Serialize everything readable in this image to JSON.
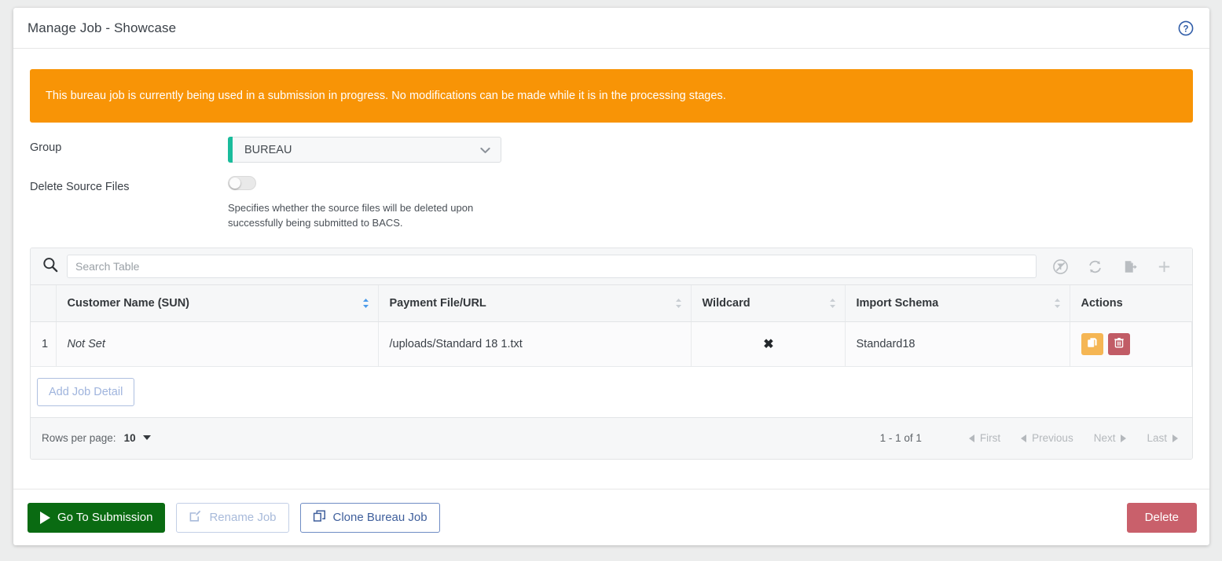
{
  "header": {
    "title": "Manage Job - Showcase",
    "help_icon": "help-circle-icon"
  },
  "banner": {
    "text": "This bureau job is currently being used in a submission in progress. No modifications can be made while it is in the processing stages.",
    "color": "#f89406"
  },
  "form": {
    "group": {
      "label": "Group",
      "value": "BUREAU",
      "accent_color": "#1abc9c"
    },
    "delete_source_files": {
      "label": "Delete Source Files",
      "state": "off",
      "help_text": "Specifies whether the source files will be deleted upon successfully being submitted to BACS."
    }
  },
  "table": {
    "search": {
      "placeholder": "Search Table",
      "value": ""
    },
    "toolbar": [
      {
        "name": "clear-filter-icon",
        "label": "Clear Filters"
      },
      {
        "name": "refresh-icon",
        "label": "Refresh"
      },
      {
        "name": "export-icon",
        "label": "Export"
      },
      {
        "name": "add-icon",
        "label": "Add"
      }
    ],
    "columns": [
      {
        "label": "Customer Name (SUN)",
        "sortable": true,
        "sort_active": true
      },
      {
        "label": "Payment File/URL",
        "sortable": true,
        "sort_active": false
      },
      {
        "label": "Wildcard",
        "sortable": true,
        "sort_active": false
      },
      {
        "label": "Import Schema",
        "sortable": true,
        "sort_active": false
      },
      {
        "label": "Actions",
        "sortable": false,
        "sort_active": false
      }
    ],
    "rows": [
      {
        "index": "1",
        "customer_name": "Not Set",
        "payment_file": "/uploads/Standard 18 1.txt",
        "wildcard": "✖",
        "import_schema": "Standard18",
        "actions": [
          {
            "name": "clone-row-button",
            "color": "#f5b654"
          },
          {
            "name": "delete-row-button",
            "color": "#c15c66"
          }
        ]
      }
    ],
    "add_button": {
      "label": "Add Job Detail",
      "disabled": true
    },
    "pagination": {
      "rows_per_page_label": "Rows per page:",
      "rows_per_page_value": "10",
      "range": "1 - 1 of 1",
      "first": "First",
      "previous": "Previous",
      "next": "Next",
      "last": "Last"
    }
  },
  "footer": {
    "go_to_submission": "Go To Submission",
    "rename_job": "Rename Job",
    "clone_bureau_job": "Clone Bureau Job",
    "delete": "Delete",
    "colors": {
      "success": "#0a6b12",
      "danger": "#c9606b"
    }
  }
}
